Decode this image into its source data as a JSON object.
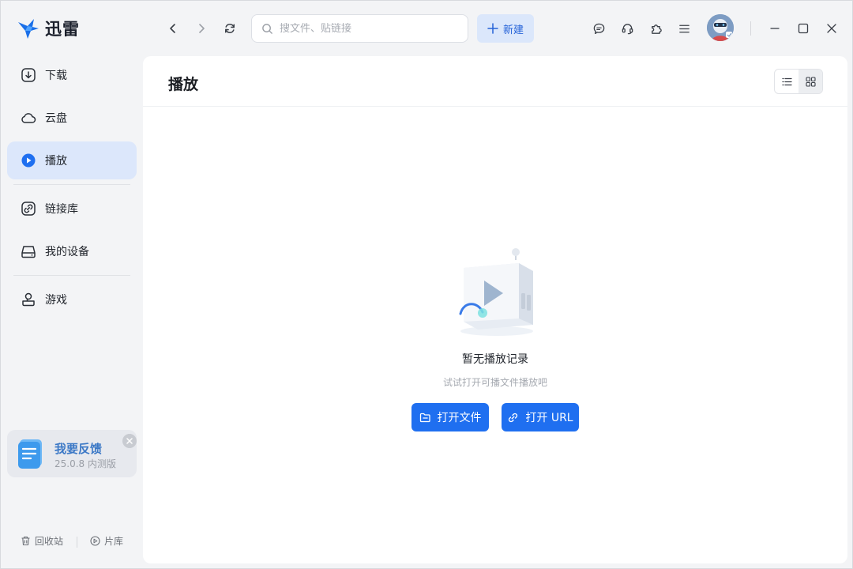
{
  "app": {
    "name": "迅雷",
    "brand_color": "#1f6ff0"
  },
  "titlebar": {
    "search_placeholder": "搜文件、贴链接",
    "new_label": "新建",
    "icons": [
      "back-icon",
      "forward-icon",
      "refresh-icon",
      "message-icon",
      "headset-icon",
      "plugin-icon",
      "menu-icon"
    ]
  },
  "sidebar": {
    "items": [
      {
        "label": "下载",
        "icon": "download-icon"
      },
      {
        "label": "云盘",
        "icon": "cloud-icon"
      },
      {
        "label": "播放",
        "icon": "play-icon",
        "active": true
      },
      {
        "label": "链接库",
        "icon": "link-library-icon"
      },
      {
        "label": "我的设备",
        "icon": "device-icon"
      },
      {
        "label": "游戏",
        "icon": "game-icon"
      }
    ],
    "feedback": {
      "title": "我要反馈",
      "version": "25.0.8 内测版"
    },
    "bottom": {
      "recycle": "回收站",
      "library": "片库"
    }
  },
  "main": {
    "title": "播放",
    "empty": {
      "title": "暂无播放记录",
      "subtitle": "试试打开可播文件播放吧"
    },
    "buttons": {
      "open_file": "打开文件",
      "open_url": "打开 URL"
    }
  }
}
